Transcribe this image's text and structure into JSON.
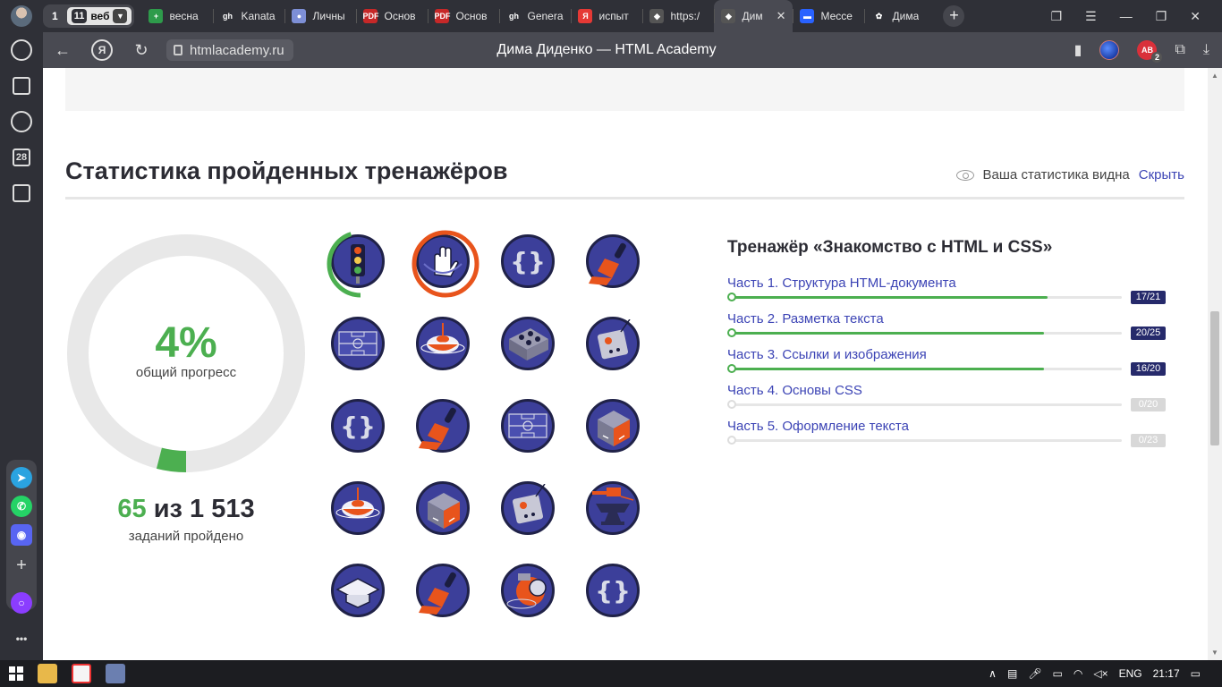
{
  "browser": {
    "tab_groups": {
      "group1": "1",
      "group2_count": "11",
      "group2_label": "веб"
    },
    "tabs": [
      {
        "title": "весна",
        "color": "#2e9b4b",
        "glyph": "+"
      },
      {
        "title": "Kanata",
        "color": "#2f3037",
        "glyph": "gh"
      },
      {
        "title": "Личны",
        "color": "#7d8fd6",
        "glyph": "●"
      },
      {
        "title": "Основ",
        "color": "#c62828",
        "glyph": "PDF"
      },
      {
        "title": "Основ",
        "color": "#c62828",
        "glyph": "PDF"
      },
      {
        "title": "Genera",
        "color": "#2f3037",
        "glyph": "gh"
      },
      {
        "title": "испыт",
        "color": "#e53935",
        "glyph": "Я"
      },
      {
        "title": "https:/",
        "color": "#555",
        "glyph": "◆"
      },
      {
        "title": "Дим",
        "color": "#555",
        "glyph": "◆",
        "active": true
      },
      {
        "title": "Мессе",
        "color": "#2962ff",
        "glyph": "▬"
      },
      {
        "title": "Дима",
        "color": "#2f3037",
        "glyph": "✿"
      }
    ],
    "address": "htmlacademy.ru",
    "page_title": "Дима Диденко — HTML Academy",
    "sidebar_calendar": "28"
  },
  "stats": {
    "section_title": "Статистика пройденных тренажёров",
    "visibility_text": "Ваша статистика видна",
    "hide_link": "Скрыть",
    "overall_progress": 0.04,
    "percent_text": "4%",
    "percent_label": "общий прогресс",
    "tasks_done": "65",
    "tasks_of": "из 1 513",
    "tasks_label": "заданий пройдено"
  },
  "badges": [
    {
      "icon": "traffic-light-icon",
      "progress": 0.45,
      "color": "#4caf50"
    },
    {
      "icon": "hand-icon",
      "progress": 1,
      "color": "#e8541c"
    },
    {
      "icon": "braces-icon",
      "progress": 0
    },
    {
      "icon": "paintbrush-icon",
      "progress": 0
    },
    {
      "icon": "football-field-icon",
      "progress": 0
    },
    {
      "icon": "spinning-top-icon",
      "progress": 0
    },
    {
      "icon": "lego-brick-icon",
      "progress": 0
    },
    {
      "icon": "control-box-icon",
      "progress": 0
    },
    {
      "icon": "braces-icon",
      "progress": 0
    },
    {
      "icon": "paintbrush-icon",
      "progress": 0
    },
    {
      "icon": "football-field-icon",
      "progress": 0
    },
    {
      "icon": "rubik-cube-icon",
      "progress": 0
    },
    {
      "icon": "spinning-top-icon",
      "progress": 0
    },
    {
      "icon": "rubik-cube-icon",
      "progress": 0
    },
    {
      "icon": "control-box-icon",
      "progress": 0
    },
    {
      "icon": "anvil-icon",
      "progress": 0
    },
    {
      "icon": "graduation-cap-icon",
      "progress": 0
    },
    {
      "icon": "paintbrush-icon",
      "progress": 0
    },
    {
      "icon": "diving-helmet-icon",
      "progress": 0
    },
    {
      "icon": "braces-icon",
      "progress": 0
    }
  ],
  "trainer": {
    "title": "Тренажёр «Знакомство с HTML и CSS»",
    "parts": [
      {
        "label": "Часть 1. Структура HTML-документа",
        "done": 17,
        "total": 21,
        "count_text": "17/21"
      },
      {
        "label": "Часть 2. Разметка текста",
        "done": 20,
        "total": 25,
        "count_text": "20/25"
      },
      {
        "label": "Часть 3. Ссылки и изображения",
        "done": 16,
        "total": 20,
        "count_text": "16/20"
      },
      {
        "label": "Часть 4. Основы CSS",
        "done": 0,
        "total": 20,
        "count_text": "0/20"
      },
      {
        "label": "Часть 5. Оформление текста",
        "done": 0,
        "total": 23,
        "count_text": "0/23"
      }
    ]
  },
  "taskbar": {
    "lang": "ENG",
    "time": "21:17"
  },
  "colors": {
    "accent_green": "#4caf50",
    "brand_blue": "#3c44b5",
    "badge_bg": "#3c3f9a",
    "count_badge": "#262a6b"
  }
}
